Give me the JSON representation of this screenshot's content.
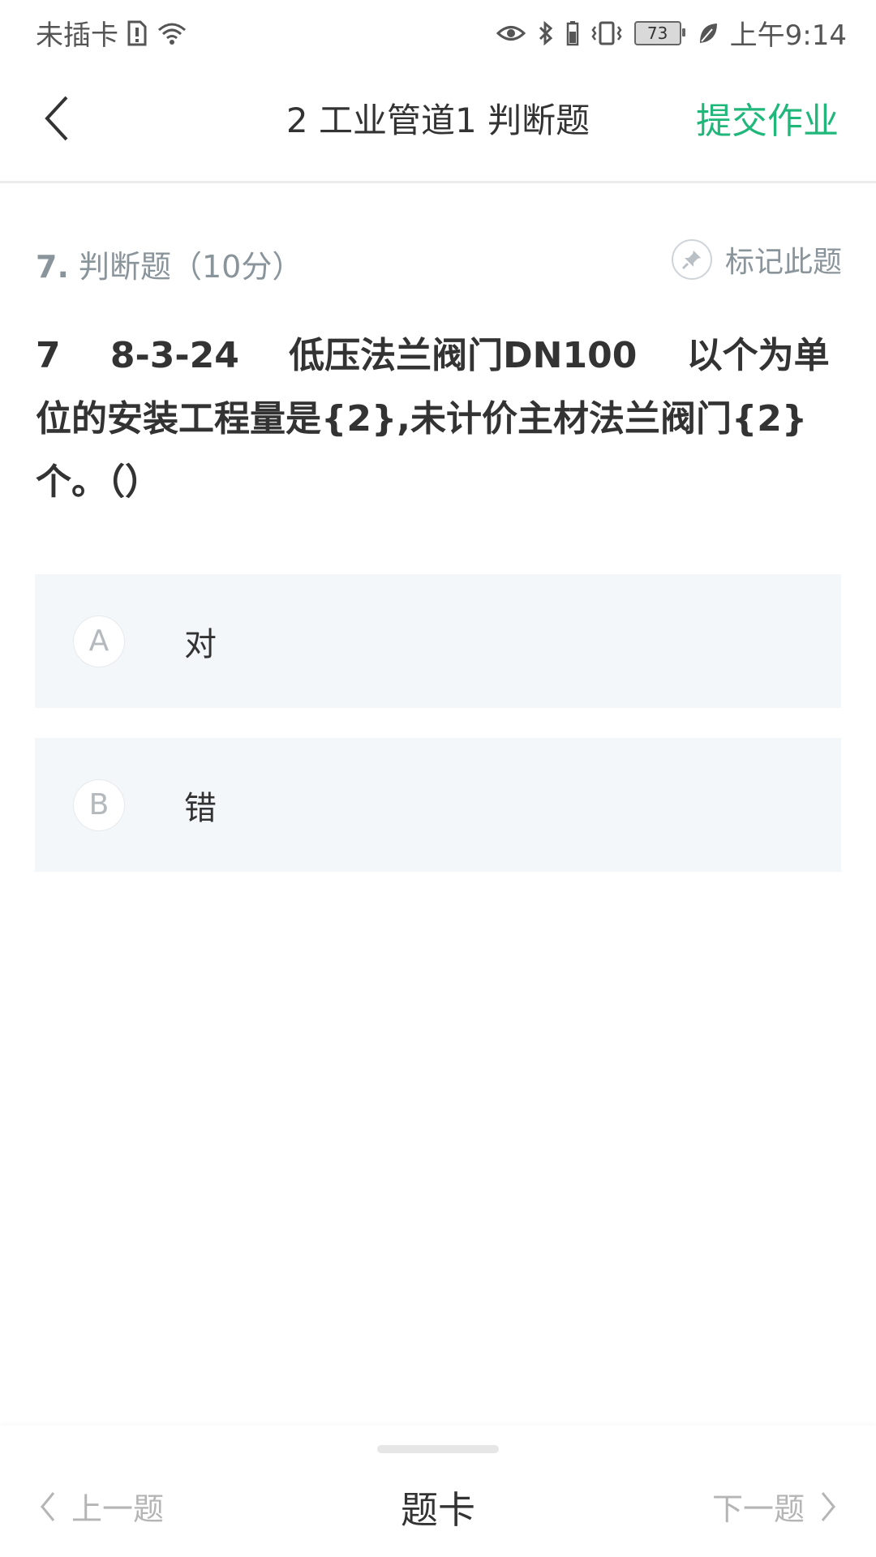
{
  "status_bar": {
    "carrier": "未插卡",
    "battery": "73",
    "time": "上午9:14"
  },
  "header": {
    "title": "2 工业管道1 判断题",
    "submit_label": "提交作业"
  },
  "question": {
    "number": "7.",
    "type_score": "判断题（10分）",
    "mark_label": "标记此题",
    "text": "7    8-3-24    低压法兰阀门DN100    以个为单位的安装工程量是{2},未计价主材法兰阀门{2}个。（）"
  },
  "options": [
    {
      "letter": "A",
      "text": "对"
    },
    {
      "letter": "B",
      "text": "错"
    }
  ],
  "bottom_bar": {
    "prev_label": "上一题",
    "card_label": "题卡",
    "next_label": "下一题"
  },
  "colors": {
    "accent": "#1fb77a",
    "option_bg": "#f4f7f9",
    "meta_text": "#8a949b"
  }
}
